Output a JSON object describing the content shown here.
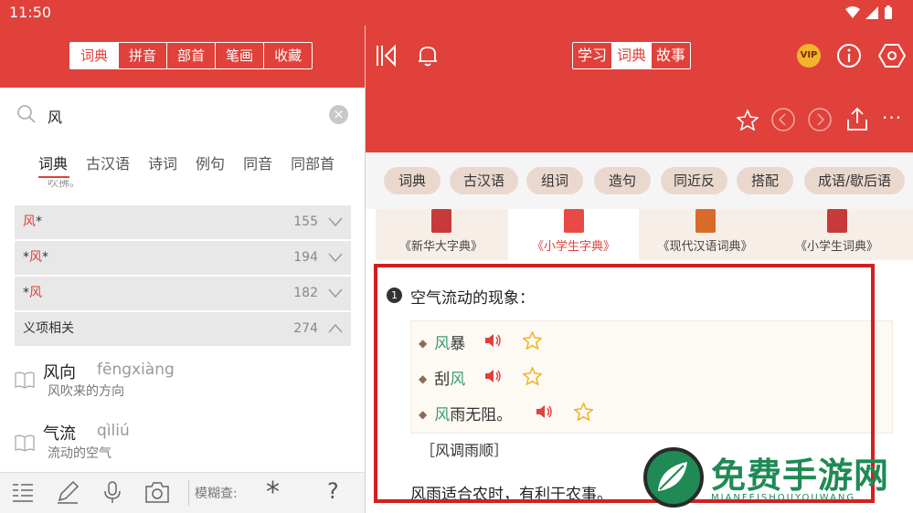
{
  "status": {
    "time": "11:50"
  },
  "left": {
    "mode_tabs": [
      {
        "label": "词典",
        "active": true
      },
      {
        "label": "拼音",
        "active": false
      },
      {
        "label": "部首",
        "active": false
      },
      {
        "label": "笔画",
        "active": false
      },
      {
        "label": "收藏",
        "active": false
      }
    ],
    "search": {
      "value": "风",
      "clear_label": "×"
    },
    "categories": [
      {
        "label": "词典",
        "active": true
      },
      {
        "label": "古汉语",
        "active": false
      },
      {
        "label": "诗词",
        "active": false
      },
      {
        "label": "例句",
        "active": false
      },
      {
        "label": "同音",
        "active": false
      },
      {
        "label": "同部首",
        "active": false
      }
    ],
    "cut_text": "吹拂。",
    "groups": [
      {
        "prefix": "",
        "red": "风",
        "suffix": "*",
        "count": "155"
      },
      {
        "prefix": "*",
        "red": "风",
        "suffix": "*",
        "count": "194"
      },
      {
        "prefix": "*",
        "red": "风",
        "suffix": "",
        "count": "182"
      },
      {
        "prefix": "义项相关",
        "red": "",
        "suffix": "",
        "count": "274"
      }
    ],
    "entries": [
      {
        "word": "风向",
        "pinyin": "fēngxiàng",
        "definition": "风吹来的方向"
      },
      {
        "word": "气流",
        "pinyin": "qìliú",
        "definition": "流动的空气"
      }
    ],
    "bottom": {
      "fuzzy_label": "模糊查:",
      "wildcard": "*",
      "help": "?"
    }
  },
  "right": {
    "nav_tabs": [
      {
        "label": "学习",
        "active": false
      },
      {
        "label": "词典",
        "active": true
      },
      {
        "label": "故事",
        "active": false
      }
    ],
    "vip_label": "VIP",
    "toolbar": {
      "more": "···"
    },
    "chips": [
      "词典",
      "古汉语",
      "组词",
      "造句",
      "同近反",
      "搭配",
      "成语/歇后语"
    ],
    "books": [
      {
        "title": "《新华大字典》",
        "active": false,
        "color": "#c73a3a"
      },
      {
        "title": "《小学生字典》",
        "active": true,
        "color": "#e84a45"
      },
      {
        "title": "《现代汉语词典》",
        "active": false,
        "color": "#d96b2a"
      },
      {
        "title": "《小学生词典》",
        "active": false,
        "color": "#c73a3a"
      }
    ],
    "sense": {
      "number": "1",
      "text": "空气流动的现象："
    },
    "examples": [
      {
        "parts": [
          {
            "t": "风",
            "g": true
          },
          {
            "t": "暴",
            "g": false
          }
        ]
      },
      {
        "parts": [
          {
            "t": "刮",
            "g": false
          },
          {
            "t": "风",
            "g": true
          }
        ]
      },
      {
        "parts": [
          {
            "t": "风",
            "g": true
          },
          {
            "t": "雨无阻。",
            "g": false
          }
        ]
      }
    ],
    "idiom": "［风调雨顺］",
    "idiom_definition": "风雨适合农时，有利于农事。"
  },
  "watermark": {
    "title": "免费手游网",
    "subtitle": "MIANFEISHOUYOUWANG"
  },
  "colors": {
    "brand_red": "#e0413b",
    "highlight_red": "#d31f1f",
    "example_green": "#3c9a74",
    "vip_gold": "#f2b428"
  }
}
